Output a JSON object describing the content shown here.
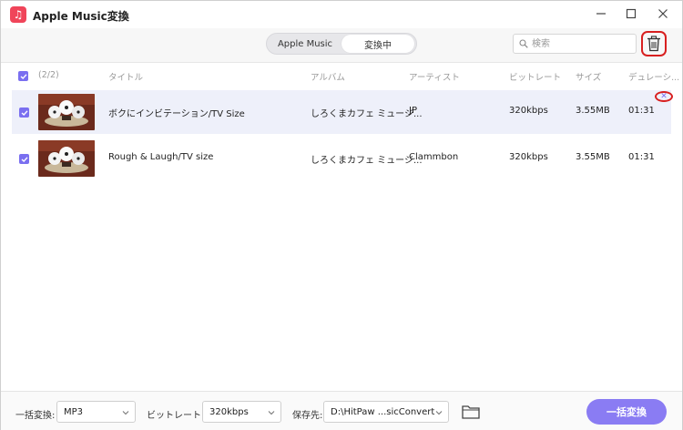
{
  "window": {
    "title": "Apple Music変換",
    "app_icon": "music-note-icon",
    "controls": [
      "minimize-icon",
      "maximize-icon",
      "close-icon"
    ]
  },
  "toolbar": {
    "tabs": [
      {
        "label": "Apple Music",
        "active": false
      },
      {
        "label": "変換中",
        "active": true
      }
    ],
    "search_placeholder": "検索",
    "delete_all_icon": "trash-icon"
  },
  "list": {
    "select_all_checked": true,
    "count": "(2/2)",
    "columns": [
      "タイトル",
      "アルバム",
      "アーティスト",
      "ビットレート",
      "サイズ",
      "デュレーシ..."
    ],
    "rows": [
      {
        "checked": true,
        "title": "ボクにインビテーション/TV Size",
        "album": "しろくまカフェ ミュージ...",
        "artist": "JP",
        "bitrate": "320kbps",
        "size": "3.55MB",
        "duration": "01:31",
        "selected": true
      },
      {
        "checked": true,
        "title": "Rough & Laugh/TV size",
        "album": "しろくまカフェ ミュージ...",
        "artist": "Clammbon",
        "bitrate": "320kbps",
        "size": "3.55MB",
        "duration": "01:31",
        "selected": false
      }
    ]
  },
  "bottom": {
    "format_label": "一括変換:",
    "format_value": "MP3",
    "bitrate_label": "ビットレート:",
    "bitrate_value": "320kbps",
    "save_label": "保存先:",
    "save_value": "D:\\HitPaw ...sicConvert",
    "convert_button": "一括変換"
  },
  "colors": {
    "accent": "#8a7cf3",
    "highlight": "#d82020",
    "selected_row": "#eef0fa"
  }
}
